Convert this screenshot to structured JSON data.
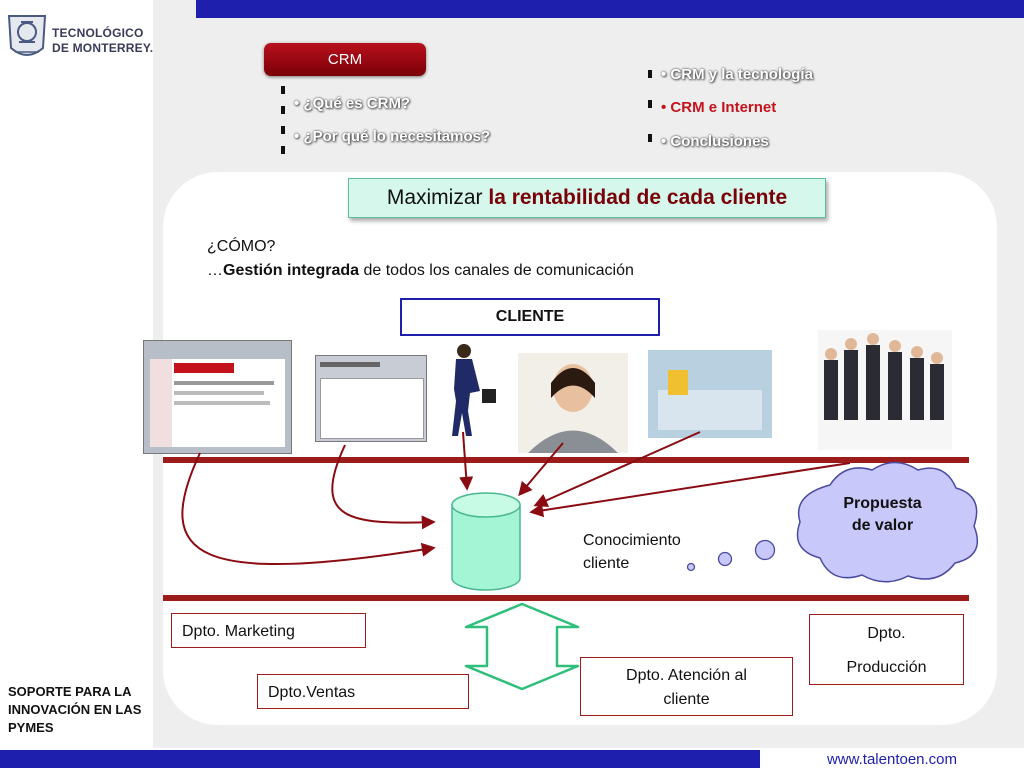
{
  "logo": {
    "line1": "TECNOLÓGICO",
    "line2": "DE MONTERREY."
  },
  "sidebar_caption": {
    "line1": "SOPORTE PARA LA",
    "line2": "INNOVACIÓN EN LAS",
    "line3": "PYMES"
  },
  "footer": {
    "url": "www.talentoen.com"
  },
  "nav": {
    "crm_tab": "CRM",
    "left_items": [
      "• ¿Qué es CRM?",
      "• ¿Por qué lo necesitamos?"
    ],
    "right_items": [
      "• CRM y la tecnología",
      "• CRM e Internet",
      "• Conclusiones"
    ],
    "active": "• CRM e Internet"
  },
  "headline": {
    "part1": "Maximizar ",
    "part2": "la rentabilidad de cada cliente"
  },
  "how": {
    "question": "¿CÓMO?",
    "prefix": "…",
    "bold": "Gestión integrada",
    "rest": " de todos los canales de comunicación"
  },
  "client_label": "CLIENTE",
  "knowledge_label": {
    "line1": "Conocimiento",
    "line2": "cliente"
  },
  "value_cloud": {
    "line1": "Propuesta",
    "line2": "de valor"
  },
  "departments": {
    "marketing": "Dpto. Marketing",
    "ventas": "Dpto.Ventas",
    "atencion_line1": "Dpto. Atención al",
    "atencion_line2": "cliente",
    "produccion_line1": "Dpto.",
    "produccion_line2": "Producción"
  },
  "colors": {
    "accent_red": "#9c1c1c",
    "dark_red": "#7a0008",
    "active_red": "#c4131d",
    "blue_bar": "#1f1fae",
    "db_green": "#a4f5d6",
    "cloud_fill": "#c8c8fb"
  },
  "icons": [
    "seal-icon",
    "database-icon",
    "cloud-icon",
    "double-arrow-icon"
  ]
}
